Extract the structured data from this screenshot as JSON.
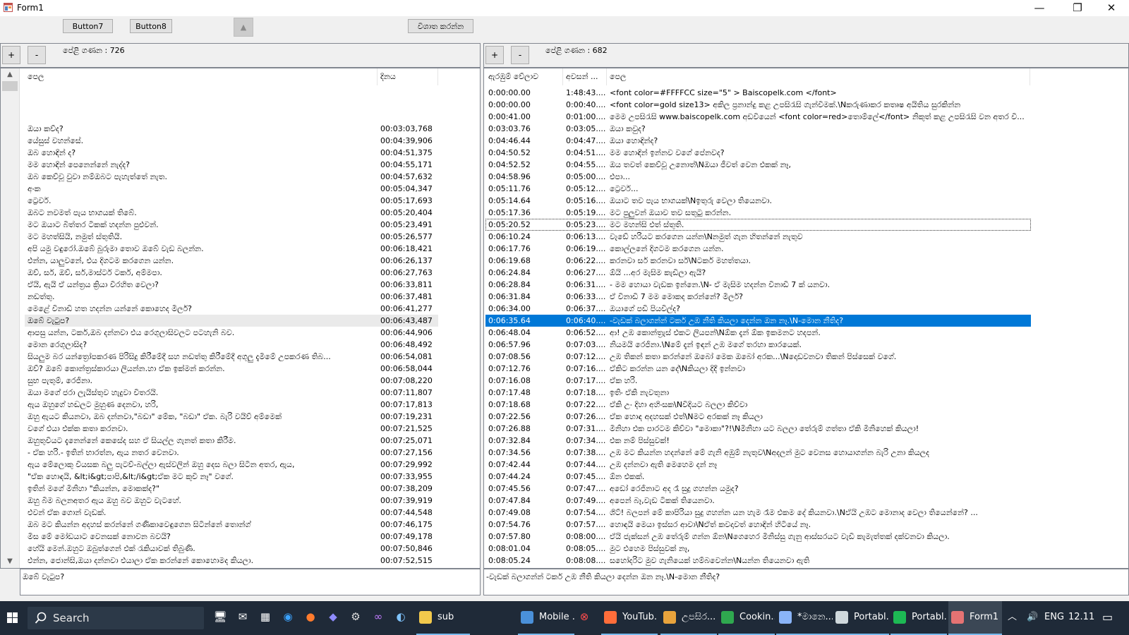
{
  "window": {
    "title": "Form1",
    "minimize": "—",
    "maximize": "❐",
    "close": "✕"
  },
  "toolbar": {
    "button7": "Button7",
    "button8": "Button8",
    "up_arrow": "▲",
    "action": "විශාත කරන්න"
  },
  "left_panel": {
    "plus": "+",
    "minus": "-",
    "row_count": "පේළි ගණන : 726",
    "col_text": "පෙල",
    "col_date": "දිනය",
    "scroll_up": "▲",
    "scroll_down": "▼",
    "rows": [
      {
        "text": "",
        "time": ""
      },
      {
        "text": "",
        "time": ""
      },
      {
        "text": "",
        "time": ""
      },
      {
        "text": "ඔයා කව්ද?",
        "time": "00:03:03,768"
      },
      {
        "text": "යේසුස් වහන්සේ.",
        "time": "00:04:39,906"
      },
      {
        "text": "ඔබ හොඳින් ද?",
        "time": "00:04:51,375"
      },
      {
        "text": "මම හොඳින් පෙනෙන්නේ නැද්ද?",
        "time": "00:04:55,171"
      },
      {
        "text": "ඔබ කෙව්වූ වුවා නම්ඔබට පැහැත්තේ නැත.",
        "time": "00:04:57,632"
      },
      {
        "text": "අංක",
        "time": "00:05:04,347"
      },
      {
        "text": "ට්‍රෙවර්.",
        "time": "00:05:17,693"
      },
      {
        "text": "ඔබට නවමත් පැය භාගයක් තිබේ.",
        "time": "00:05:20,404"
      },
      {
        "text": "මට ඔයාට බිත්තර ටිකක් හදන්න පුළුවන්.",
        "time": "00:05:23,491"
      },
      {
        "text": "මට මහත්සියි, නමුත් ස්තුතියි.",
        "time": "00:05:26,577"
      },
      {
        "text": "අපි යමු වඳුරෝ.ඔබේ බුරුමා තොව ඔබේ වැඩ බලන්න.",
        "time": "00:06:18,421"
      },
      {
        "text": "එන්න, යාලුවනේ, එය දිගටම කරගෙන යන්න.",
        "time": "00:06:26,137"
      },
      {
        "text": "ඔව්, සර්, ඔව්, සර්,මාස්ටර් ටකර්, අම්මපා.",
        "time": "00:06:27,763"
      },
      {
        "text": "ඒයි, ඇයි ඒ යන්ත්‍රය ක්‍රියා විරහිත වෙලා?",
        "time": "00:06:33,811"
      },
      {
        "text": "නඩත්තු.",
        "time": "00:06:37,481"
      },
      {
        "text": "මෙළේ විනාඩි හත හදන්න යන්නේ කොහෙද මීලර්?",
        "time": "00:06:41,277"
      },
      {
        "text": "ඔබේ වැටුප?",
        "time": "00:06:43,487"
      },
      {
        "text": "ආපසු යන්න, ටකර්,ඔබ දන්නවා එය රෙගුලාසිවලට පටහැනි බව.",
        "time": "00:06:44,906"
      },
      {
        "text": "මොන රෙගුලාසිද?",
        "time": "00:06:48,492"
      },
      {
        "text": "සියලුම බර යන්ත්‍රෝපකරණ පිරිසිදු කිරීමේදී සහ නඩත්තු කිරීමේදී අගුලු දැමීමේ උපකරණ තිබ...",
        "time": "00:06:54,081"
      },
      {
        "text": "ඔව්? ඔබේ කොන්ත්‍රස්කාරයා ලියන්න.හා ඒක ඉක්මන් කරන්න.",
        "time": "00:06:58,044"
      },
      {
        "text": "සුභ පැතුම්, රෙජිනා.",
        "time": "00:07:08,220"
      },
      {
        "text": "ඔයා මගේ ජරා ලැයිස්තුව හැදුවා විතරයි.",
        "time": "00:07:11,807"
      },
      {
        "text": "ඇය ඔහුගේ හඬලට මුහුණ දෙනවා, හරි,",
        "time": "00:07:17,813"
      },
      {
        "text": "ඔහු ඇයට කියනවා, ඔබ දන්නවා,\"බඩා\" මේක, \"බඩා\" ඒක. බැරි වයිව් අම්මෙක්",
        "time": "00:07:19,231"
      },
      {
        "text": "වගේ එයා එක්ක කතා කරනවා.",
        "time": "00:07:21,525"
      },
      {
        "text": "ඔහුතුවියට දැනෙන්නේ කෙසේද සහ ඒ සියල්ල ගැනත් කතා කිරීම.",
        "time": "00:07:25,071"
      },
      {
        "text": "- ඒක හරි.- ඉතින් භාරත්න, ඇය නතර වෙනවා.",
        "time": "00:07:27,156"
      },
      {
        "text": "ඇය මේලොකු වියසක බලු පැටව්-බල්ලා ඇස්වලින් ඔහු දෙස බලා සිටින අතර, ඇය,",
        "time": "00:07:29,992"
      },
      {
        "text": "\"ඒක හොඳයි, &lt;i&gt;පාපි,&lt;/i&gt;ඒක මට කුවි නෑ\" වගේ.",
        "time": "00:07:33,955"
      },
      {
        "text": "ඉතින් මගේ මිනිහා \"කියන්න, මොකක්ද?\"",
        "time": "00:07:38,209"
      },
      {
        "text": "ඔහු බිම බලනඅතර ඇය ඔහු බව ඔහුට වැටහේ.",
        "time": "00:07:39,919"
      },
      {
        "text": "එවන් ඒක ගොන් වැඩක්.",
        "time": "00:07:44,548"
      },
      {
        "text": "ඔබ මට කියන්න අදහස් කරන්නේ ගණිකාවෙඳුගෙන සිටින්නේ තොන්ග්",
        "time": "00:07:46,175"
      },
      {
        "text": "මිස මේ මෝඩයාට වෙනසක් නොවන බවයි?",
        "time": "00:07:49,178"
      },
      {
        "text": "හේයි මෙන්.ඔහුට ඔබුත්ගෙන් එක් රැකියාවක් තිබුණි.",
        "time": "00:07:50,846"
      },
      {
        "text": "එන්න, ජොන්සි,ඔයා දන්නවා එයාලා ඒක කරන්නේ කොහොමද කියලා.",
        "time": "00:07:52,515"
      }
    ],
    "textbox": "ඔබේ වැටුප?"
  },
  "right_panel": {
    "plus": "+",
    "minus": "-",
    "row_count": "පේළි ගණන : 682",
    "col_start": "ඇරඹුම් වේලාව",
    "col_end": "අවසන් ...",
    "col_text": "පෙල",
    "rows": [
      {
        "start": "0:00:00.00",
        "end": "1:48:43....",
        "text": "<font color=#FFFFCC size=\"5\" > Baiscopelk.com </font>"
      },
      {
        "start": "0:00:00.00",
        "end": "0:00:40....",
        "text": "<font color=gold size13> අකිල ප්‍රනාන්දු කළ උපසිරැසි ගැන්විමක්.\\Nකරුණාකර කතෘෂ අයිතිය සුරකින්න"
      },
      {
        "start": "0:00:41.00",
        "end": "0:01:00....",
        "text": "මෙම උපසිරැසි www.baiscopelk.com අඩවියෙන් <font color=red>තොම්ලේ</font> නිකුත් කළ උපසිරැසි වන අතර වි..."
      },
      {
        "start": "0:03:03.76",
        "end": "0:03:05....",
        "text": "ඔයා කවුද?"
      },
      {
        "start": "0:04:46.44",
        "end": "0:04:47....",
        "text": "ඔයා හොඳින්ද?"
      },
      {
        "start": "0:04:50.52",
        "end": "0:04:51....",
        "text": "මම හොඳින් ඉන්නව වගේ පේනවද?"
      },
      {
        "start": "0:04:52.52",
        "end": "0:04:55....",
        "text": "ඔය තවත් කෙව්වූ උනොත්\\Nඔයා ජීවත් වෙන එකක් නෑ,"
      },
      {
        "start": "0:04:58.96",
        "end": "0:05:00....",
        "text": "එපා..."
      },
      {
        "start": "0:05:11.76",
        "end": "0:05:12....",
        "text": "ට්‍රෙවර්..."
      },
      {
        "start": "0:05:14.64",
        "end": "0:05:16....",
        "text": "ඔයාට තව පැය භාගයක්\\Nඉතුරු වෙලා තියෙනවා."
      },
      {
        "start": "0:05:17.36",
        "end": "0:05:19....",
        "text": "මට පුලුවන් ඔයාව තව සතුටු කරන්න."
      },
      {
        "start": "0:05:20.52",
        "end": "0:05:23....",
        "text": "මට මහන්සි එත් ස්තුති.",
        "focus": true
      },
      {
        "start": "0:06:10.24",
        "end": "0:06:13....",
        "text": "වැඩේ හරියට කරගෙන යන්න\\Nනමුත් ගැන හිතන්නේ නැතුව"
      },
      {
        "start": "0:06:17.76",
        "end": "0:06:19....",
        "text": "කොල්ලනේ දිගටම කරගෙන යන්න."
      },
      {
        "start": "0:06:19.68",
        "end": "0:06:22....",
        "text": "කරනවා සර් කරනවා සර්\\Nටකර් මහත්තයා."
      },
      {
        "start": "0:06:24.84",
        "end": "0:06:27....",
        "text": "ඕයි ...අර මැසිම කැඩිලා ඇයි?"
      },
      {
        "start": "0:06:28.84",
        "end": "0:06:31....",
        "text": "- මම හොයා වැඩක ඉන්නෙ.\\N- ඒ මැසිම හදන්න විනාඩි 7 ක් යනවා."
      },
      {
        "start": "0:06:31.84",
        "end": "0:06:33....",
        "text": "ඒ විනාඩි 7 මම මොකද කරන්නේ? මීලර්?"
      },
      {
        "start": "0:06:34.00",
        "end": "0:06:37....",
        "text": "ඔයාගේ පඩි පියවිල්ද?"
      },
      {
        "start": "0:06:35.64",
        "end": "0:06:40....",
        "text": "-වැඩක් බලාගන්න් ටකර් උඹ නීති කියලා දෙන්න ඔන නෑ.\\N-මොන නීතිද?",
        "selected": true
      },
      {
        "start": "0:06:48.04",
        "end": "0:06:52....",
        "text": "ආ! උඹ කොන්ත්‍රැස් එකට ලියපන්\\Nඕක දැන් ඕක ඉකමනට හදපන්."
      },
      {
        "start": "0:06:57.96",
        "end": "0:07:03....",
        "text": "නියමයි රෙජිනා.\\Nමේ දැන් ඉඳන් උඹ මගේ තරහා කාරයෙක්."
      },
      {
        "start": "0:07:08.56",
        "end": "0:07:12....",
        "text": "උඹ තිකන් කතා කරන්නේ ඔබෝ මෙක ඔබෝ අරක...\\Nදොඩවනවා තිකන් පිස්සෙක් වගේ."
      },
      {
        "start": "0:07:12.76",
        "end": "0:07:16....",
        "text": "ඒකිට කරන්න යන දේ\\Nකියලා දිදී ඉන්නවා"
      },
      {
        "start": "0:07:16.08",
        "end": "0:07:17....",
        "text": "ඒක හරි."
      },
      {
        "start": "0:07:17.48",
        "end": "0:07:18....",
        "text": "ඉතිං ඒකි නැවතුනා"
      },
      {
        "start": "0:07:18.68",
        "end": "0:07:22....",
        "text": "ඒකි උං දිහා අහිංසක\\Nවිදියට බලලා කිව්වා"
      },
      {
        "start": "0:07:22.56",
        "end": "0:07:26....",
        "text": "ඒක හොඳ අදහසක් එත්\\Nමට අරකක් නෑ කියලා"
      },
      {
        "start": "0:07:26.88",
        "end": "0:07:31....",
        "text": "මිනිහා එක පාරටම කිව්වා \"මොකා\"?!\\Nමිනිහා යට බලලා තේරුම් ගත්තා ඒකි මිනිහෙක් කියලා!"
      },
      {
        "start": "0:07:32.84",
        "end": "0:07:34....",
        "text": "එක නම් පිස්සුවක්!"
      },
      {
        "start": "0:07:34.56",
        "end": "0:07:38....",
        "text": "උඹ මට කියන්න හදන්නේ මේ ගැනි අඹුම් නැතුව\\Nඅදලන් මුට වෙනස හොයාගන්න බැරි උනා කියලද"
      },
      {
        "start": "0:07:42.44",
        "end": "0:07:44....",
        "text": "උඹ දන්නවා ඇති මෙහෙම දන් නෑ"
      },
      {
        "start": "0:07:44.24",
        "end": "0:07:45....",
        "text": "ඕන එකක්."
      },
      {
        "start": "0:07:45.56",
        "end": "0:07:47....",
        "text": "අඩෝ රෙජිනාට අද රෑ සුදු ගහන්න යමුද?"
      },
      {
        "start": "0:07:47.84",
        "end": "0:07:49....",
        "text": "අපෙන් බෑ,වැඩ ටිකක් තියෙනවා."
      },
      {
        "start": "0:07:49.08",
        "end": "0:07:54....",
        "text": "ශිට්! බලපන් මේ කාපිරියා සුදු ගහන්න යන හැම රෑම එකම දේ කියනවා.\\Nඒයි උඹට මොනාද වෙලා තියෙන්නේ? ..."
      },
      {
        "start": "0:07:54.76",
        "end": "0:07:57....",
        "text": "හොඳයි මෙයා ඉස්සර ආවා\\Nඒත් කවදාවත් හොඳින් හිටියේ නෑ."
      },
      {
        "start": "0:07:57.80",
        "end": "0:08:00....",
        "text": "ඒයි ජැක්සන් උඹ තේරුම් ගන්න ඕන\\Nගෙහෙර මිනිස්සු ගැනු ආස්සරයට වැඩි කැමැත්තක් දක්වනවා කියලා."
      },
      {
        "start": "0:08:01.04",
        "end": "0:08:05....",
        "text": "මුට එහෙම පිස්සුවක් නෑ,"
      },
      {
        "start": "0:08:05.24",
        "end": "0:08:08....",
        "text": "සහෝදරිට මුව ගැනියෙක් හම්බවෙන්න\\Nයන්න තියෙනවා ඇති"
      }
    ],
    "textbox": "-වැඩක් බලාගන්න් ටකර් උඹ නීති කියලා දෙන්න ඔන නෑ.\\N-මොන නීතිද?"
  },
  "taskbar": {
    "search_label": "Search",
    "apps": [
      {
        "label": "sub",
        "color": "#f2c94c"
      },
      {
        "label": "Mobile ...",
        "color": "#4a90d9"
      },
      {
        "label": "YouTub...",
        "color": "#ff6d3a"
      },
      {
        "label": "උපසිර...",
        "color": "#e8a33c"
      },
      {
        "label": "Cookin...",
        "color": "#2fa84f"
      },
      {
        "label": "*මානෙ...",
        "color": "#8ab4f8"
      },
      {
        "label": "Portabl...",
        "color": "#cfd8dc"
      },
      {
        "label": "Portabl...",
        "color": "#1db954"
      },
      {
        "label": "Form1",
        "color": "#e57373"
      }
    ],
    "tray_lang": "ENG",
    "tray_time": "12.11"
  }
}
